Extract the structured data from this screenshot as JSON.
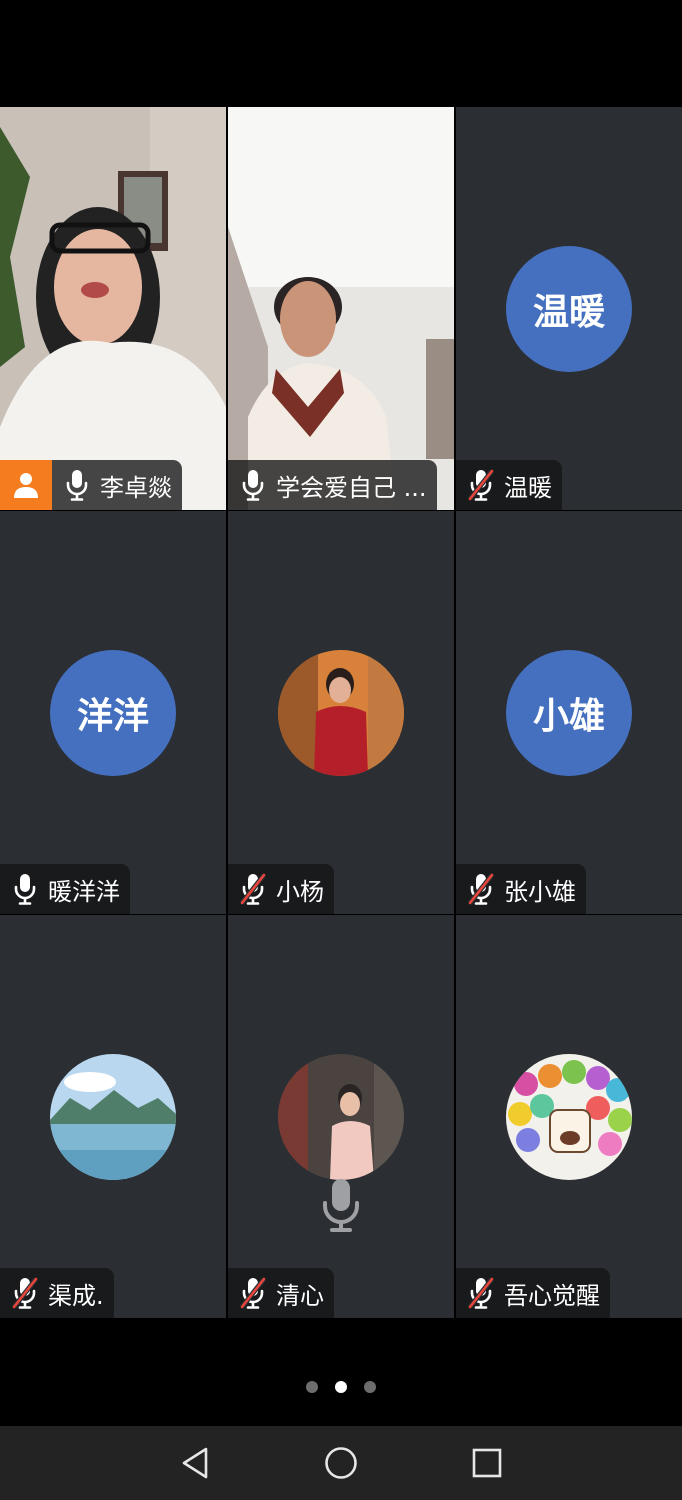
{
  "participants": [
    {
      "name": "李卓燚",
      "mic": "on",
      "avatar_type": "video",
      "active_speaker": true,
      "host": true
    },
    {
      "name": "学会爱自己 ...",
      "mic": "on",
      "avatar_type": "video"
    },
    {
      "name": "温暖",
      "mic": "muted",
      "avatar_type": "initials",
      "initials": "温暖"
    },
    {
      "name": "暖洋洋",
      "mic": "on",
      "avatar_type": "initials",
      "initials": "洋洋"
    },
    {
      "name": "小杨",
      "mic": "muted",
      "avatar_type": "photo"
    },
    {
      "name": "张小雄",
      "mic": "muted",
      "avatar_type": "initials",
      "initials": "小雄"
    },
    {
      "name": "渠成.",
      "mic": "muted",
      "avatar_type": "photo"
    },
    {
      "name": "清心",
      "mic": "muted",
      "avatar_type": "photo",
      "speaking_indicator": true
    },
    {
      "name": "吾心觉醒",
      "mic": "muted",
      "avatar_type": "photo"
    }
  ],
  "pager": {
    "count": 3,
    "active_index": 1
  },
  "colors": {
    "tile_bg": "#2b2e32",
    "active_border": "#39c257",
    "initials_bg": "#4470bf",
    "host_badge": "#f57d1f",
    "mute_slash": "#e8453c"
  },
  "icons": {
    "mic_on": "microphone-icon",
    "mic_muted": "microphone-muted-icon",
    "host": "person-icon",
    "nav_back": "back-triangle-icon",
    "nav_home": "home-circle-icon",
    "nav_recents": "recents-square-icon"
  }
}
